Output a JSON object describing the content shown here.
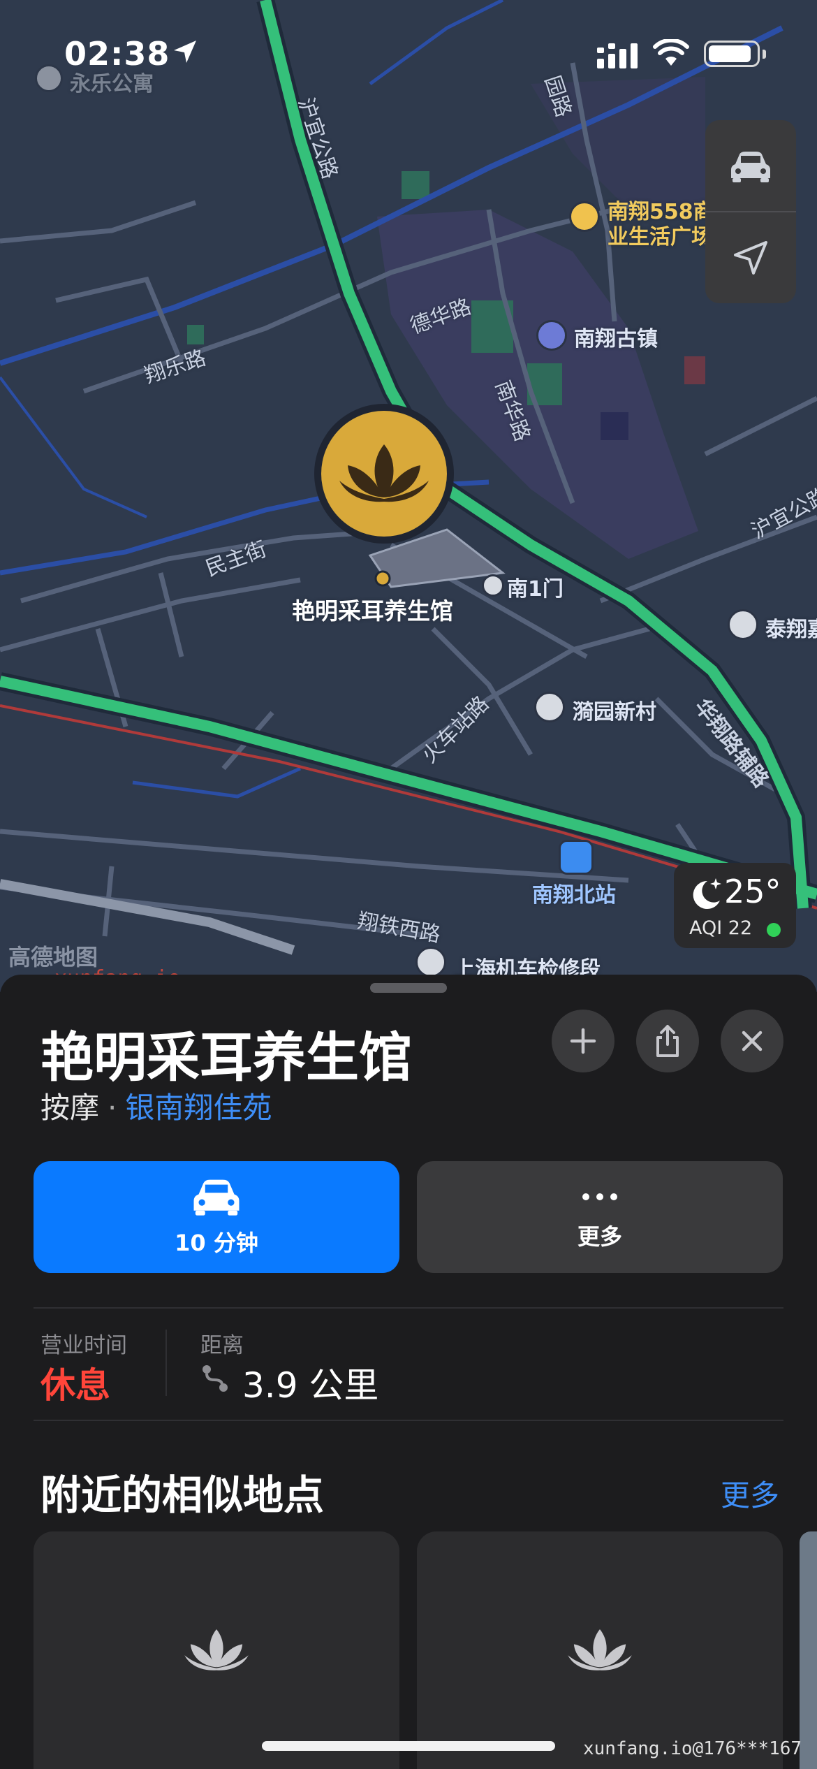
{
  "status_bar": {
    "time": "02:38"
  },
  "map": {
    "road_labels": {
      "huyi_road": "沪宜公路",
      "dehua_road": "德华路",
      "xiangle_road": "翔乐路",
      "minzhu_street": "民主街",
      "nanhua_road": "南华路",
      "huoche_station_road": "火车站路",
      "huaxiang_aux_road": "华翔路辅路",
      "xiangtie_west_road": "翔铁西路",
      "huyi_road_east": "沪宜公路",
      "gu_road": "园路"
    },
    "pois": {
      "yongle": "永乐公寓",
      "nanxiang558": "南翔558商",
      "nanxiang558_line2": "业生活广场",
      "nanxiang_old_town": "南翔古镇",
      "south_gate": "南1门",
      "taixiang": "泰翔嘉",
      "yiyuan_village": "漪园新村",
      "nanxiang_north_station": "南翔北站",
      "shanghai_depot": "上海机车检修段",
      "selected_place": "艳明采耳养生馆"
    },
    "weather": {
      "temperature": "25°",
      "aqi": "AQI 22"
    },
    "watermark_map": "高德地图",
    "watermark_site": "xunfang.io"
  },
  "sheet": {
    "title": "艳明采耳养生馆",
    "category": "按摩",
    "separator": "·",
    "location_link": "银南翔佳苑",
    "actions": {
      "drive_label": "10 分钟",
      "more_label": "更多"
    },
    "info": {
      "hours_label": "营业时间",
      "hours_value": "休息",
      "distance_label": "距离",
      "distance_value": "3.9 公里"
    },
    "nearby": {
      "title": "附近的相似地点",
      "more_link": "更多"
    }
  },
  "watermark_bottom": "xunfang.io@176***167",
  "colors": {
    "accent_blue": "#0a7aff",
    "closed_red": "#ff453a",
    "road_green": "#35c07a",
    "selected_pin_gold": "#d9a93a",
    "aqi_green": "#30d158"
  }
}
